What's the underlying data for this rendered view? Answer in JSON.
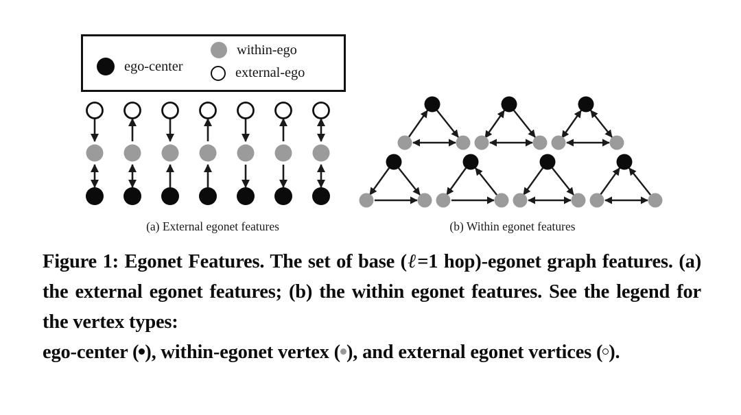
{
  "legend": {
    "items": [
      {
        "id": "ego-center",
        "label": "ego-center",
        "swatch": "filled-black-circle",
        "color": "#0b0b0b"
      },
      {
        "id": "within-ego",
        "label": "within-ego",
        "swatch": "filled-gray-circle",
        "color": "#9b9b9b"
      },
      {
        "id": "external-ego",
        "label": "external-ego",
        "swatch": "open-circle",
        "color": "#ffffff"
      }
    ]
  },
  "panels": {
    "a": {
      "caption": "(a)  External egonet features",
      "columns": 7
    },
    "b": {
      "caption": "(b)  Within egonet features",
      "triangles": 7
    }
  },
  "figure_caption": {
    "line1": "Figure 1: Egonet Features. The set of base (",
    "ell": "ℓ",
    "line1b": "=1 hop)-egonet",
    "line2": "graph features. (a) the external egonet features; (b) the",
    "line3": "within egonet features. See the legend for the vertex types:",
    "line4a": "ego-center (",
    "line4b": "), within-egonet vertex (",
    "line4c": "), and external egonet",
    "line5a": "vertices (",
    "line5b": ")."
  },
  "colors": {
    "ego_center": "#0b0b0b",
    "within_ego": "#9b9b9b",
    "external_ego_stroke": "#111111",
    "edge": "#1a1a1a",
    "background": "#ffffff"
  },
  "chart_data": {
    "type": "diagram",
    "title": "Egonet Features",
    "panel_a": {
      "name": "External egonet features",
      "node_types_top_to_bottom": [
        "external-ego",
        "within-ego",
        "ego-center"
      ],
      "columns": [
        {
          "index": 1,
          "upper_edge": "down",
          "lower_edge": "both"
        },
        {
          "index": 2,
          "upper_edge": "up",
          "lower_edge": "both"
        },
        {
          "index": 3,
          "upper_edge": "down",
          "lower_edge": "up"
        },
        {
          "index": 4,
          "upper_edge": "up",
          "lower_edge": "up"
        },
        {
          "index": 5,
          "upper_edge": "down",
          "lower_edge": "down"
        },
        {
          "index": 6,
          "upper_edge": "up",
          "lower_edge": "down"
        },
        {
          "index": 7,
          "upper_edge": "both",
          "lower_edge": "both"
        }
      ]
    },
    "panel_b": {
      "name": "Within egonet features",
      "node_types": {
        "apex": "ego-center",
        "left": "within-ego",
        "right": "within-ego"
      },
      "triangles": [
        {
          "index": 1,
          "row": 1,
          "left_edge": "to-apex",
          "right_edge": "from-apex",
          "base_edge": "both"
        },
        {
          "index": 2,
          "row": 1,
          "left_edge": "both",
          "right_edge": "from-apex",
          "base_edge": "both"
        },
        {
          "index": 3,
          "row": 1,
          "left_edge": "both",
          "right_edge": "both",
          "base_edge": "both"
        },
        {
          "index": 4,
          "row": 2,
          "left_edge": "from-apex",
          "right_edge": "from-apex",
          "base_edge": "left-to-right"
        },
        {
          "index": 5,
          "row": 2,
          "left_edge": "from-apex",
          "right_edge": "to-apex",
          "base_edge": "left-to-right"
        },
        {
          "index": 6,
          "row": 2,
          "left_edge": "from-apex",
          "right_edge": "from-apex",
          "base_edge": "both"
        },
        {
          "index": 7,
          "row": 2,
          "left_edge": "to-apex",
          "right_edge": "to-apex",
          "base_edge": "both"
        }
      ]
    }
  }
}
